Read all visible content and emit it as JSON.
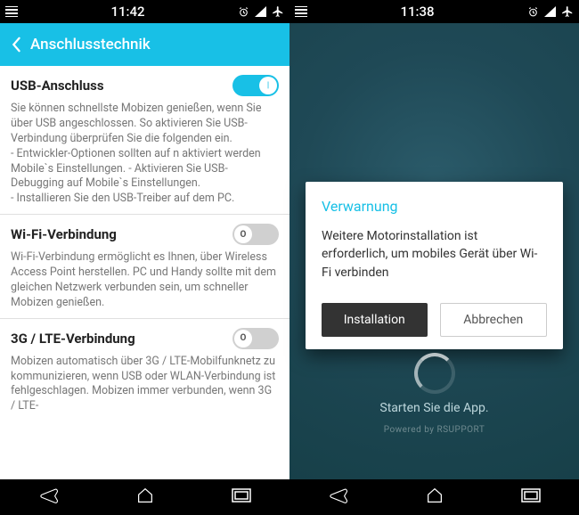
{
  "left": {
    "status": {
      "time": "11:42"
    },
    "header": {
      "title": "Anschlusstechnik"
    },
    "sections": [
      {
        "title": "USB-Anschluss",
        "toggle": true,
        "desc": "Sie können schnellste Mobizen genießen, wenn Sie über USB angeschlossen. So aktivieren Sie USB-Verbindung überprüfen Sie die folgenden ein.\n - Entwickler-Optionen sollten auf n aktiviert werden Mobile`s Einstellungen. - Aktivieren Sie USB-Debugging auf Mobile`s Einstellungen.\n - Installieren Sie den USB-Treiber auf dem PC."
      },
      {
        "title": "Wi-Fi-Verbindung",
        "toggle": false,
        "desc": "Wi-Fi-Verbindung ermöglicht es Ihnen, über Wireless Access Point herstellen. PC und Handy sollte mit dem gleichen Netzwerk verbunden sein, um schneller Mobizen genießen."
      },
      {
        "title": "3G / LTE-Verbindung",
        "toggle": false,
        "desc": "Mobizen automatisch über 3G / LTE-Mobilfunknetz zu kommunizieren, wenn USB oder WLAN-Verbindung ist fehlgeschlagen. Mobizen immer verbunden, wenn 3G / LTE-"
      }
    ]
  },
  "right": {
    "status": {
      "time": "11:38"
    },
    "dialog": {
      "title": "Verwarnung",
      "body": "Weitere Motorinstallation ist erforderlich, um mobiles Gerät über Wi-Fi verbinden",
      "primary": "Installation",
      "secondary": "Abbrechen"
    },
    "start_text": "Starten Sie die App.",
    "powered": "Powered by RSUPPORT"
  }
}
